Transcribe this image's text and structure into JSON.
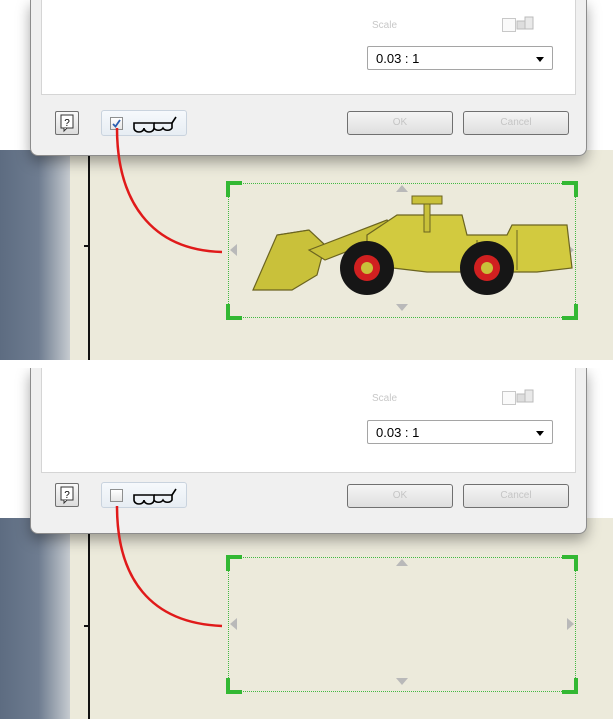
{
  "panels": [
    {
      "id": "with-preview",
      "scale": {
        "label": "Scale",
        "value": "0.03 : 1"
      },
      "preview_toggle_checked": true,
      "buttons": {
        "ok": "OK",
        "cancel": "Cancel"
      },
      "icons": {
        "help": "help-icon",
        "preview": "glasses-icon",
        "object": "loader-vehicle-icon"
      },
      "colors": {
        "callout": "#e01a1a",
        "frame": "#43b943",
        "vehicle": "#c9c13a"
      }
    },
    {
      "id": "without-preview",
      "scale": {
        "label": "Scale",
        "value": "0.03 : 1"
      },
      "preview_toggle_checked": false,
      "buttons": {
        "ok": "OK",
        "cancel": "Cancel"
      },
      "icons": {
        "help": "help-icon",
        "preview": "glasses-icon"
      },
      "colors": {
        "callout": "#e01a1a",
        "frame": "#43b943"
      }
    }
  ]
}
